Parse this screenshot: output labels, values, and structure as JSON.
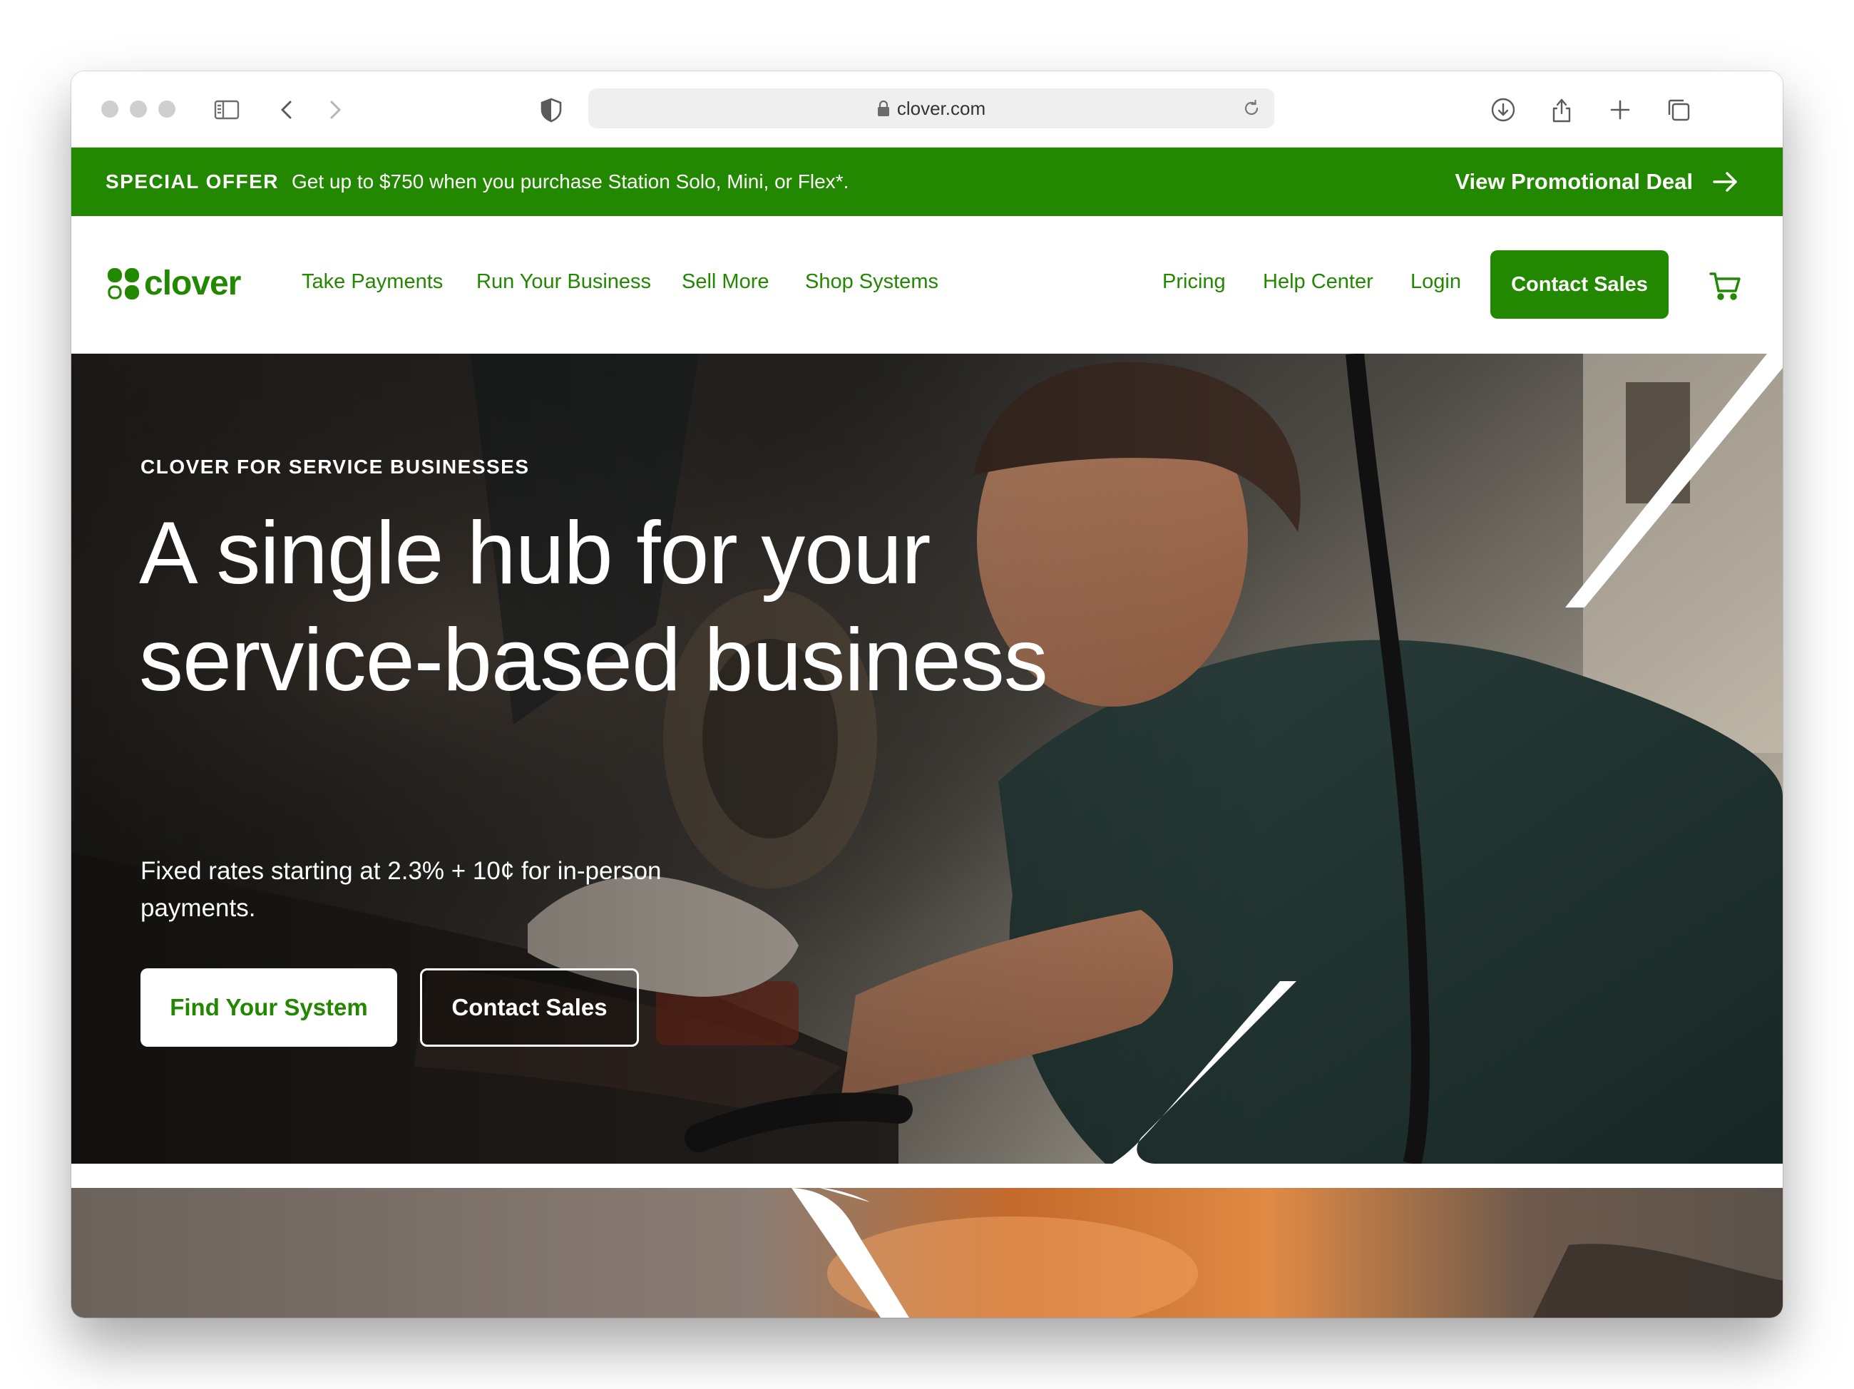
{
  "browser": {
    "url": "clover.com"
  },
  "promo": {
    "tag": "SPECIAL OFFER",
    "text": "Get up to $750 when you purchase Station Solo, Mini, or Flex*.",
    "link_label": "View Promotional Deal"
  },
  "nav": {
    "logo_text": "clover",
    "items": [
      {
        "label": "Take Payments"
      },
      {
        "label": "Run Your Business"
      },
      {
        "label": "Sell More"
      },
      {
        "label": "Shop Systems"
      }
    ],
    "right_items": [
      {
        "label": "Pricing"
      },
      {
        "label": "Help Center"
      },
      {
        "label": "Login"
      }
    ],
    "cta_label": "Contact Sales"
  },
  "hero": {
    "eyebrow": "CLOVER FOR SERVICE BUSINESSES",
    "title": "A single hub for your service-based business",
    "subtitle": "Fixed rates starting at 2.3% + 10¢ for in-person payments.",
    "primary_button": "Find Your System",
    "secondary_button": "Contact Sales"
  },
  "colors": {
    "brand_green": "#228800",
    "white": "#ffffff"
  },
  "icons": [
    "sidebar-icon",
    "back-icon",
    "forward-icon",
    "shield-icon",
    "lock-icon",
    "reload-icon",
    "download-icon",
    "share-icon",
    "new-tab-icon",
    "tabs-icon",
    "arrow-right-icon",
    "clover-logo-icon",
    "cart-icon"
  ]
}
